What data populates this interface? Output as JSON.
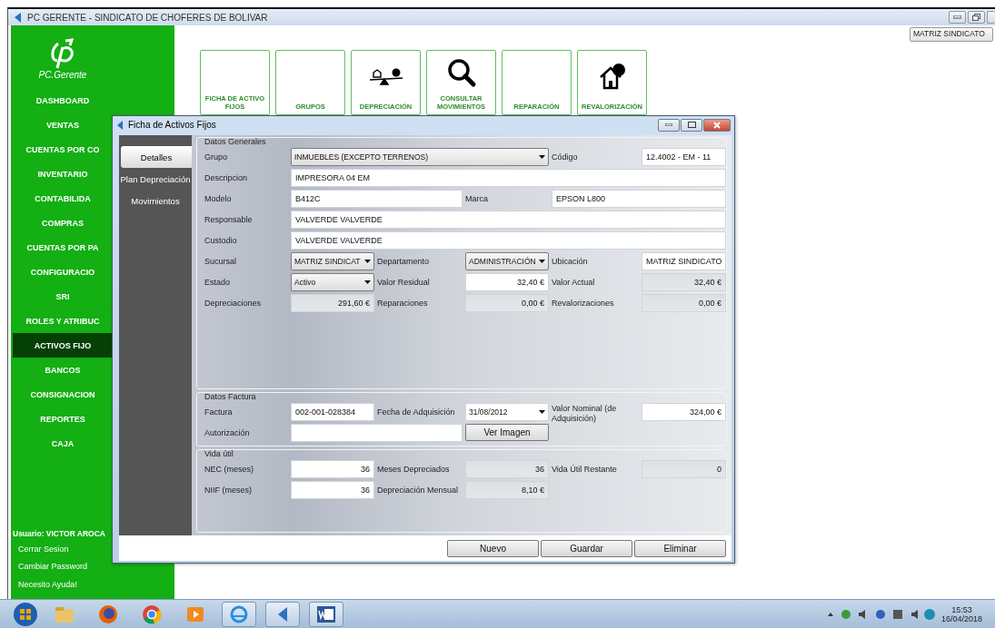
{
  "window": {
    "title": "PC GERENTE - SINDICATO DE CHOFERES DE BOLIVAR"
  },
  "branch_selector": {
    "value": "MATRIZ SINDICATO"
  },
  "sidebar": {
    "logo_text": "PC.Gerente",
    "items": [
      {
        "label": "DASHBOARD",
        "selected": false
      },
      {
        "label": "VENTAS",
        "selected": false
      },
      {
        "label": "CUENTAS POR CO",
        "selected": false
      },
      {
        "label": "INVENTARIO",
        "selected": false
      },
      {
        "label": "CONTABILIDA",
        "selected": false
      },
      {
        "label": "COMPRAS",
        "selected": false
      },
      {
        "label": "CUENTAS POR PA",
        "selected": false
      },
      {
        "label": "CONFIGURACIO",
        "selected": false
      },
      {
        "label": "SRI",
        "selected": false
      },
      {
        "label": "ROLES Y ATRIBUC",
        "selected": false
      },
      {
        "label": "ACTIVOS FIJO",
        "selected": true
      },
      {
        "label": "BANCOS",
        "selected": false
      },
      {
        "label": "CONSIGNACION",
        "selected": false
      },
      {
        "label": "REPORTES",
        "selected": false
      },
      {
        "label": "CAJA",
        "selected": false
      }
    ],
    "user": "Usuario: VICTOR AROCA",
    "links": [
      "Cerrar Sesion",
      "Cambiar Password",
      "Necesito Ayuda!"
    ]
  },
  "toolbar": [
    {
      "label": "FICHA DE ACTIVO FIJOS",
      "kind": "plain"
    },
    {
      "label": "GRUPOS",
      "kind": "plain"
    },
    {
      "label": "DEPRECIACIÓN",
      "kind": "scale"
    },
    {
      "label": "CONSULTAR MOVIMIENTOS",
      "kind": "search"
    },
    {
      "label": "REPARACIÓN",
      "kind": "plain"
    },
    {
      "label": "REVALORIZACIÓN",
      "kind": "house"
    }
  ],
  "dialog": {
    "title": "Ficha de Activos Fijos",
    "tabs": [
      {
        "label": "Detalles",
        "selected": true
      },
      {
        "label": "Plan Depreciación",
        "selected": false
      },
      {
        "label": "Movimientos",
        "selected": false
      }
    ],
    "sections": [
      {
        "title": "Datos Generales",
        "fields": [
          {
            "label": "Grupo",
            "kind": "dropdown",
            "value": "INMUEBLES (EXCEPTO TERRENOS)"
          },
          {
            "label": "Código",
            "kind": "text",
            "value": "12.4002 - EM - 11"
          },
          {
            "label": "Descripcion",
            "kind": "text",
            "value": "IMPRESORA  04 EM"
          },
          {
            "label": "Modelo",
            "kind": "text",
            "value": "B412C"
          },
          {
            "label": "Marca",
            "kind": "text",
            "value": "EPSON L800"
          },
          {
            "label": "Responsable",
            "kind": "text",
            "value": "VALVERDE VALVERDE"
          },
          {
            "label": "Custodio",
            "kind": "text",
            "value": "VALVERDE VALVERDE"
          },
          {
            "label": "Sucursal",
            "kind": "dropdown",
            "value": "MATRIZ SINDICAT"
          },
          {
            "label": "Departamento",
            "kind": "dropdown",
            "value": "ADMINISTRACIÓN"
          },
          {
            "label": "Ubicación",
            "kind": "text",
            "value": "MATRIZ SINDICATO"
          },
          {
            "label": "Estado",
            "kind": "dropdown",
            "value": "Activo"
          },
          {
            "label": "Valor Residual",
            "kind": "number",
            "value": "32,40 €"
          },
          {
            "label": "Valor Actual",
            "kind": "readonly",
            "value": "32,40 €"
          },
          {
            "label": "Depreciaciones",
            "kind": "readonly",
            "value": "291,60 €"
          },
          {
            "label": "Reparaciones",
            "kind": "readonly",
            "value": "0,00 €"
          },
          {
            "label": "Revalorizaciones",
            "kind": "readonly",
            "value": "0,00 €"
          }
        ]
      },
      {
        "title": "Datos Factura",
        "fields": [
          {
            "label": "Factura",
            "kind": "text",
            "value": "002-001-028384"
          },
          {
            "label": "Fecha de Adquisición",
            "kind": "date",
            "value": "31/08/2012"
          },
          {
            "label": "Valor Nominal (de Adquisición)",
            "kind": "number",
            "value": "324,00 €"
          },
          {
            "label": "Autorización",
            "kind": "text"
          },
          {
            "kind": "button",
            "value": "Ver Imagen"
          }
        ]
      },
      {
        "title": "Vida útil",
        "fields": [
          {
            "label": "NEC (meses)",
            "kind": "number",
            "value": "36"
          },
          {
            "label": "Meses Depreciados",
            "kind": "readonly",
            "value": "36"
          },
          {
            "label": "Vida Útil Restante",
            "kind": "readonly",
            "value": "0"
          },
          {
            "label": "NIIF (meses)",
            "kind": "number",
            "value": "36"
          },
          {
            "label": "Depreciación Mensual",
            "kind": "readonly",
            "value": "8,10 €"
          }
        ]
      }
    ],
    "buttons": [
      "Nuevo",
      "Guardar",
      "Eliminar"
    ]
  },
  "taskbar": {
    "time": "15:53",
    "date": "16/04/2018"
  }
}
